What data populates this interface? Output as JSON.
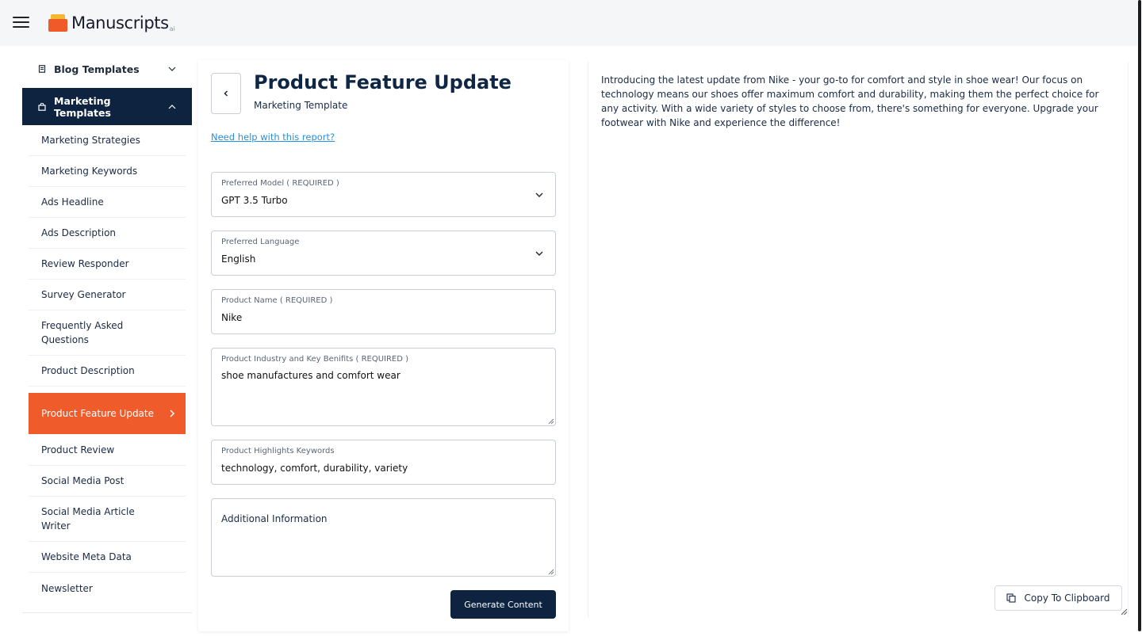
{
  "header": {
    "app_name": "Manuscripts",
    "app_suffix": "ai",
    "menu_icon": "hamburger-menu-icon",
    "logo_icon": "envelope-logo-icon"
  },
  "sidebar": {
    "groups": [
      {
        "label": "Blog Templates",
        "icon": "document-icon",
        "expanded": false
      },
      {
        "label": "Marketing Templates",
        "icon": "bag-icon",
        "expanded": true
      }
    ],
    "items": [
      {
        "label": "Marketing Strategies"
      },
      {
        "label": "Marketing Keywords"
      },
      {
        "label": "Ads Headline"
      },
      {
        "label": "Ads Description"
      },
      {
        "label": "Review Responder"
      },
      {
        "label": "Survey Generator"
      },
      {
        "label": "Frequently Asked Questions"
      },
      {
        "label": "Product Description"
      },
      {
        "label": "Product Feature Update",
        "active": true
      },
      {
        "label": "Product Review"
      },
      {
        "label": "Social Media Post"
      },
      {
        "label": "Social Media Article Writer"
      },
      {
        "label": "Website Meta Data"
      },
      {
        "label": "Newsletter"
      }
    ],
    "active_color": "#ef5b2b",
    "group_active_color": "#0d2340"
  },
  "form": {
    "title": "Product Feature Update",
    "subtitle": "Marketing Template",
    "help_link": "Need help with this report?",
    "fields": {
      "model": {
        "label": "Preferred Model ( REQUIRED )",
        "value": "GPT 3.5 Turbo"
      },
      "language": {
        "label": "Preferred Language",
        "value": "English"
      },
      "product_name": {
        "label": "Product Name ( REQUIRED )",
        "value": "Nike"
      },
      "industry": {
        "label": "Product Industry and Key Benifits ( REQUIRED )",
        "value": "shoe manufactures and comfort wear"
      },
      "keywords": {
        "label": "Product Highlights Keywords",
        "value": "technology, comfort, durability, variety"
      },
      "additional": {
        "placeholder": "Additional Information",
        "value": ""
      }
    },
    "generate_label": "Generate Content"
  },
  "output": {
    "text": "Introducing the latest update from Nike - your go-to for comfort and style in shoe wear! Our focus on technology means our shoes offer maximum comfort and durability, making them the perfect choice for any activity. With a wide variety of styles to choose from, there's something for everyone. Upgrade your footwear with Nike and experience the difference!",
    "copy_label": "Copy To Clipboard",
    "copy_icon": "copy-icon"
  }
}
